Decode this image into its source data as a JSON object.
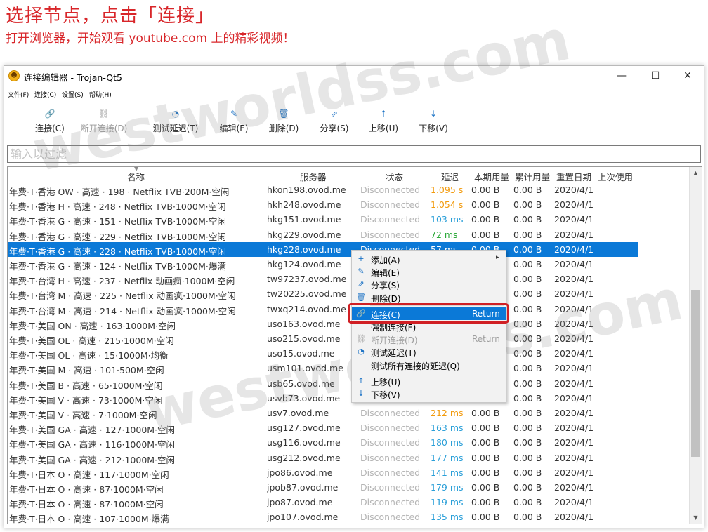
{
  "banner": {
    "title": "选择节点，点击「连接」",
    "subtitle": "打开浏览器，开始观看 youtube.com 上的精彩视频！"
  },
  "window": {
    "title": "连接编辑器 - Trojan-Qt5",
    "minimize": "—",
    "maximize": "☐",
    "close": "✕"
  },
  "menu": [
    "文件(F)",
    "连接(C)",
    "设置(S)",
    "帮助(H)"
  ],
  "toolbar": [
    {
      "label": "连接(C)",
      "icon": "🔗",
      "disabled": false
    },
    {
      "label": "断开连接(D)",
      "icon": "⛓",
      "disabled": true
    },
    {
      "label": "测试延迟(T)",
      "icon": "◔",
      "disabled": false
    },
    {
      "label": "编辑(E)",
      "icon": "✎",
      "disabled": false
    },
    {
      "label": "删除(D)",
      "icon": "🗑",
      "disabled": false
    },
    {
      "label": "分享(S)",
      "icon": "⇗",
      "disabled": false
    },
    {
      "label": "上移(U)",
      "icon": "↑",
      "disabled": false
    },
    {
      "label": "下移(V)",
      "icon": "↓",
      "disabled": false
    }
  ],
  "filter": {
    "placeholder": "输入以过滤"
  },
  "table": {
    "headers": [
      "名称",
      "服务器",
      "状态",
      "延迟",
      "本期用量",
      "累计用量",
      "重置日期",
      "上次使用"
    ],
    "rows": [
      {
        "name": "年费·T·香港 OW · 高速 · 198 · Netflix TVB·200M·空闲",
        "server": "hkon198.ovod.me",
        "status": "Disconnected",
        "latency": "1.095 s",
        "latency_color": "#f29a0c",
        "up": "0.00  B",
        "total": "0.00  B",
        "date": "2020/4/1"
      },
      {
        "name": "年费·T·香港 H · 高速 · 248 · Netflix TVB·1000M·空闲",
        "server": "hkh248.ovod.me",
        "status": "Disconnected",
        "latency": "1.054 s",
        "latency_color": "#f29a0c",
        "up": "0.00  B",
        "total": "0.00  B",
        "date": "2020/4/1"
      },
      {
        "name": "年费·T·香港 G · 高速 · 151 · Netflix TVB·1000M·空闲",
        "server": "hkg151.ovod.me",
        "status": "Disconnected",
        "latency": "103 ms",
        "latency_color": "#2a9fd8",
        "up": "0.00  B",
        "total": "0.00  B",
        "date": "2020/4/1"
      },
      {
        "name": "年费·T·香港 G · 高速 · 229 · Netflix TVB·1000M·空闲",
        "server": "hkg229.ovod.me",
        "status": "Disconnected",
        "latency": "72 ms",
        "latency_color": "#2aa838",
        "up": "0.00  B",
        "total": "0.00  B",
        "date": "2020/4/1"
      },
      {
        "name": "年费·T·香港 G · 高速 · 228 · Netflix TVB·1000M·空闲",
        "server": "hkg228.ovod.me",
        "status": "Disconnected",
        "latency": "57 ms",
        "latency_color": "#ffffff",
        "up": "0.00  B",
        "total": "0.00  B",
        "date": "2020/4/1",
        "selected": true
      },
      {
        "name": "年费·T·香港 G · 高速 · 124 · Netflix TVB·1000M·爆满",
        "server": "hkg124.ovod.me",
        "status": "",
        "latency": "",
        "latency_color": "#2a9fd8",
        "up": "",
        "total": "0.00  B",
        "date": "2020/4/1"
      },
      {
        "name": "年费·T·台湾 H · 高速 · 237 · Netflix 动画疯·1000M·空闲",
        "server": "tw97237.ovod.me",
        "status": "",
        "latency": "",
        "latency_color": "#2a9fd8",
        "up": "",
        "total": "0.00  B",
        "date": "2020/4/1"
      },
      {
        "name": "年费·T·台湾 M · 高速 · 225 · Netflix 动画疯·1000M·空闲",
        "server": "tw20225.ovod.me",
        "status": "",
        "latency": "",
        "latency_color": "#2a9fd8",
        "up": "",
        "total": "0.00  B",
        "date": "2020/4/1"
      },
      {
        "name": "年费·T·台湾 M · 高速 · 214 · Netflix 动画疯·1000M·空闲",
        "server": "twxq214.ovod.me",
        "status": "",
        "latency": "",
        "latency_color": "#2a9fd8",
        "up": "",
        "total": "0.00  B",
        "date": "2020/4/1"
      },
      {
        "name": "年费·T·美国 ON · 高速 · 163·1000M·空闲",
        "server": "uso163.ovod.me",
        "status": "",
        "latency": "",
        "latency_color": "#2a9fd8",
        "up": "",
        "total": "0.00  B",
        "date": "2020/4/1"
      },
      {
        "name": "年费·T·美国 OL · 高速 · 215·1000M·空闲",
        "server": "uso215.ovod.me",
        "status": "",
        "latency": "",
        "latency_color": "#2a9fd8",
        "up": "",
        "total": "0.00  B",
        "date": "2020/4/1"
      },
      {
        "name": "年费·T·美国 OL · 高速 · 15·1000M·均衡",
        "server": "uso15.ovod.me",
        "status": "",
        "latency": "",
        "latency_color": "#2a9fd8",
        "up": "",
        "total": "0.00  B",
        "date": "2020/4/1"
      },
      {
        "name": "年费·T·美国 M · 高速 · 101·500M·空闲",
        "server": "usm101.ovod.me",
        "status": "",
        "latency": "",
        "latency_color": "#2a9fd8",
        "up": "",
        "total": "0.00  B",
        "date": "2020/4/1"
      },
      {
        "name": "年费·T·美国 B · 高速 · 65·1000M·空闲",
        "server": "usb65.ovod.me",
        "status": "",
        "latency": "",
        "latency_color": "#2a9fd8",
        "up": "",
        "total": "0.00  B",
        "date": "2020/4/1"
      },
      {
        "name": "年费·T·美国 V · 高速 · 73·1000M·空闲",
        "server": "usvb73.ovod.me",
        "status": "",
        "latency": "",
        "latency_color": "#2a9fd8",
        "up": "",
        "total": "0.00  B",
        "date": "2020/4/1"
      },
      {
        "name": "年费·T·美国 V · 高速 · 7·1000M·空闲",
        "server": "usv7.ovod.me",
        "status": "Disconnected",
        "latency": "212 ms",
        "latency_color": "#f29a0c",
        "up": "0.00  B",
        "total": "0.00  B",
        "date": "2020/4/1"
      },
      {
        "name": "年费·T·美国 GA · 高速 · 127·1000M·空闲",
        "server": "usg127.ovod.me",
        "status": "Disconnected",
        "latency": "163 ms",
        "latency_color": "#2a9fd8",
        "up": "0.00  B",
        "total": "0.00  B",
        "date": "2020/4/1"
      },
      {
        "name": "年费·T·美国 GA · 高速 · 116·1000M·空闲",
        "server": "usg116.ovod.me",
        "status": "Disconnected",
        "latency": "180 ms",
        "latency_color": "#2a9fd8",
        "up": "0.00  B",
        "total": "0.00  B",
        "date": "2020/4/1"
      },
      {
        "name": "年费·T·美国 GA · 高速 · 212·1000M·空闲",
        "server": "usg212.ovod.me",
        "status": "Disconnected",
        "latency": "177 ms",
        "latency_color": "#2a9fd8",
        "up": "0.00  B",
        "total": "0.00  B",
        "date": "2020/4/1"
      },
      {
        "name": "年费·T·日本 O · 高速 · 117·1000M·空闲",
        "server": "jpo86.ovod.me",
        "status": "Disconnected",
        "latency": "141 ms",
        "latency_color": "#2a9fd8",
        "up": "0.00  B",
        "total": "0.00  B",
        "date": "2020/4/1"
      },
      {
        "name": "年费·T·日本 O · 高速 · 87·1000M·空闲",
        "server": "jpob87.ovod.me",
        "status": "Disconnected",
        "latency": "179 ms",
        "latency_color": "#2a9fd8",
        "up": "0.00  B",
        "total": "0.00  B",
        "date": "2020/4/1"
      },
      {
        "name": "年费·T·日本 O · 高速 · 87·1000M·空闲",
        "server": "jpo87.ovod.me",
        "status": "Disconnected",
        "latency": "119 ms",
        "latency_color": "#2a9fd8",
        "up": "0.00  B",
        "total": "0.00  B",
        "date": "2020/4/1"
      },
      {
        "name": "年费·T·日本 O · 高速 · 107·1000M·爆满",
        "server": "jpo107.ovod.me",
        "status": "Disconnected",
        "latency": "135 ms",
        "latency_color": "#2a9fd8",
        "up": "0.00  B",
        "total": "0.00  B",
        "date": "2020/4/1"
      }
    ]
  },
  "context_menu": {
    "items": [
      {
        "label": "添加(A)",
        "icon": "+",
        "shortcut": "",
        "submenu": true,
        "disabled": false,
        "highlight": false
      },
      {
        "label": "编辑(E)",
        "icon": "✎",
        "shortcut": "",
        "submenu": false,
        "disabled": false,
        "highlight": false
      },
      {
        "label": "分享(S)",
        "icon": "⇗",
        "shortcut": "",
        "submenu": false,
        "disabled": false,
        "highlight": false
      },
      {
        "label": "删除(D)",
        "icon": "🗑",
        "shortcut": "",
        "submenu": false,
        "disabled": false,
        "highlight": false,
        "sep_after": true
      },
      {
        "label": "连接(C)",
        "icon": "🔗",
        "shortcut": "Return",
        "submenu": false,
        "disabled": false,
        "highlight": true
      },
      {
        "label": "强制连接(F)",
        "icon": "",
        "shortcut": "",
        "submenu": false,
        "disabled": false,
        "highlight": false
      },
      {
        "label": "断开连接(D)",
        "icon": "⛓",
        "shortcut": "Return",
        "submenu": false,
        "disabled": true,
        "highlight": false
      },
      {
        "label": "测试延迟(T)",
        "icon": "◔",
        "shortcut": "",
        "submenu": false,
        "disabled": false,
        "highlight": false
      },
      {
        "label": "测试所有连接的延迟(Q)",
        "icon": "",
        "shortcut": "",
        "submenu": false,
        "disabled": false,
        "highlight": false,
        "sep_after": true
      },
      {
        "label": "上移(U)",
        "icon": "↑",
        "shortcut": "",
        "submenu": false,
        "disabled": false,
        "highlight": false
      },
      {
        "label": "下移(V)",
        "icon": "↓",
        "shortcut": "",
        "submenu": false,
        "disabled": false,
        "highlight": false
      }
    ]
  },
  "watermark": "westworldss.com",
  "colors": {
    "accent": "#0b79d7",
    "banner_red": "#d8262a",
    "highlight_border": "#d01f24"
  }
}
